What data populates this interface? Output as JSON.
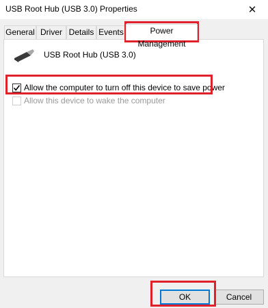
{
  "window": {
    "title": "USB Root Hub (USB 3.0) Properties",
    "close_label": "✕"
  },
  "tabs": [
    {
      "label": "General"
    },
    {
      "label": "Driver"
    },
    {
      "label": "Details"
    },
    {
      "label": "Events"
    },
    {
      "label": "Power Management",
      "active": true
    }
  ],
  "device": {
    "name": "USB Root Hub (USB 3.0)",
    "icon": "usb-connector-icon"
  },
  "options": [
    {
      "label": "Allow the computer to turn off this device to save power",
      "checked": true,
      "enabled": true
    },
    {
      "label": "Allow this device to wake the computer",
      "checked": false,
      "enabled": false
    }
  ],
  "buttons": {
    "ok": "OK",
    "cancel": "Cancel"
  },
  "colors": {
    "highlight": "#e0202a",
    "default_button_border": "#0078d7"
  }
}
